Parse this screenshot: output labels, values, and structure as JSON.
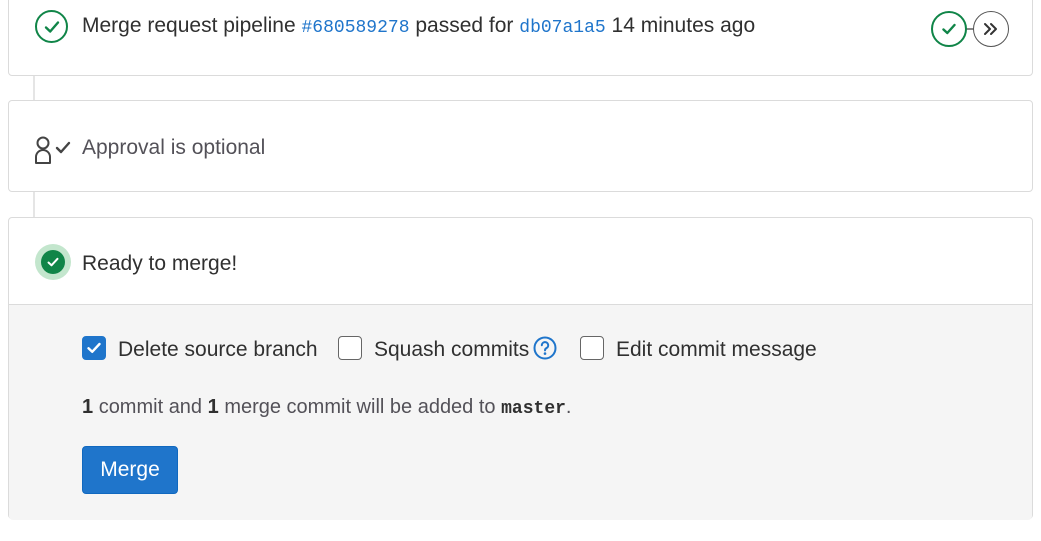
{
  "pipeline": {
    "prefix": "Merge request pipeline",
    "pipeline_id": "#680589278",
    "passed_for": "passed for",
    "commit_sha": "db07a1a5",
    "time_ago": "14 minutes ago",
    "stages": [
      {
        "name": "stage-passed",
        "icon": "check-icon",
        "status": "success"
      },
      {
        "name": "stage-downstream",
        "icon": "chevrons-right-icon",
        "status": "neutral"
      }
    ]
  },
  "approval": {
    "text": "Approval is optional",
    "icon": "approval-user-check-icon"
  },
  "merge": {
    "title": "Ready to merge!",
    "options": [
      {
        "label": "Delete source branch",
        "checked": true
      },
      {
        "label": "Squash commits",
        "checked": false,
        "help_icon": "question-circle-icon"
      },
      {
        "label": "Edit commit message",
        "checked": false
      }
    ],
    "commit_info": {
      "commit_count": "1",
      "commit_and": "commit and",
      "merge_count": "1",
      "suffix": "merge commit will be added to",
      "target_branch": "master",
      "period": "."
    },
    "button_label": "Merge"
  },
  "colors": {
    "success": "#108548",
    "link": "#1f75cb",
    "button": "#1f75cb",
    "panel_bg": "#f5f5f5",
    "border": "#dbdbdb"
  }
}
